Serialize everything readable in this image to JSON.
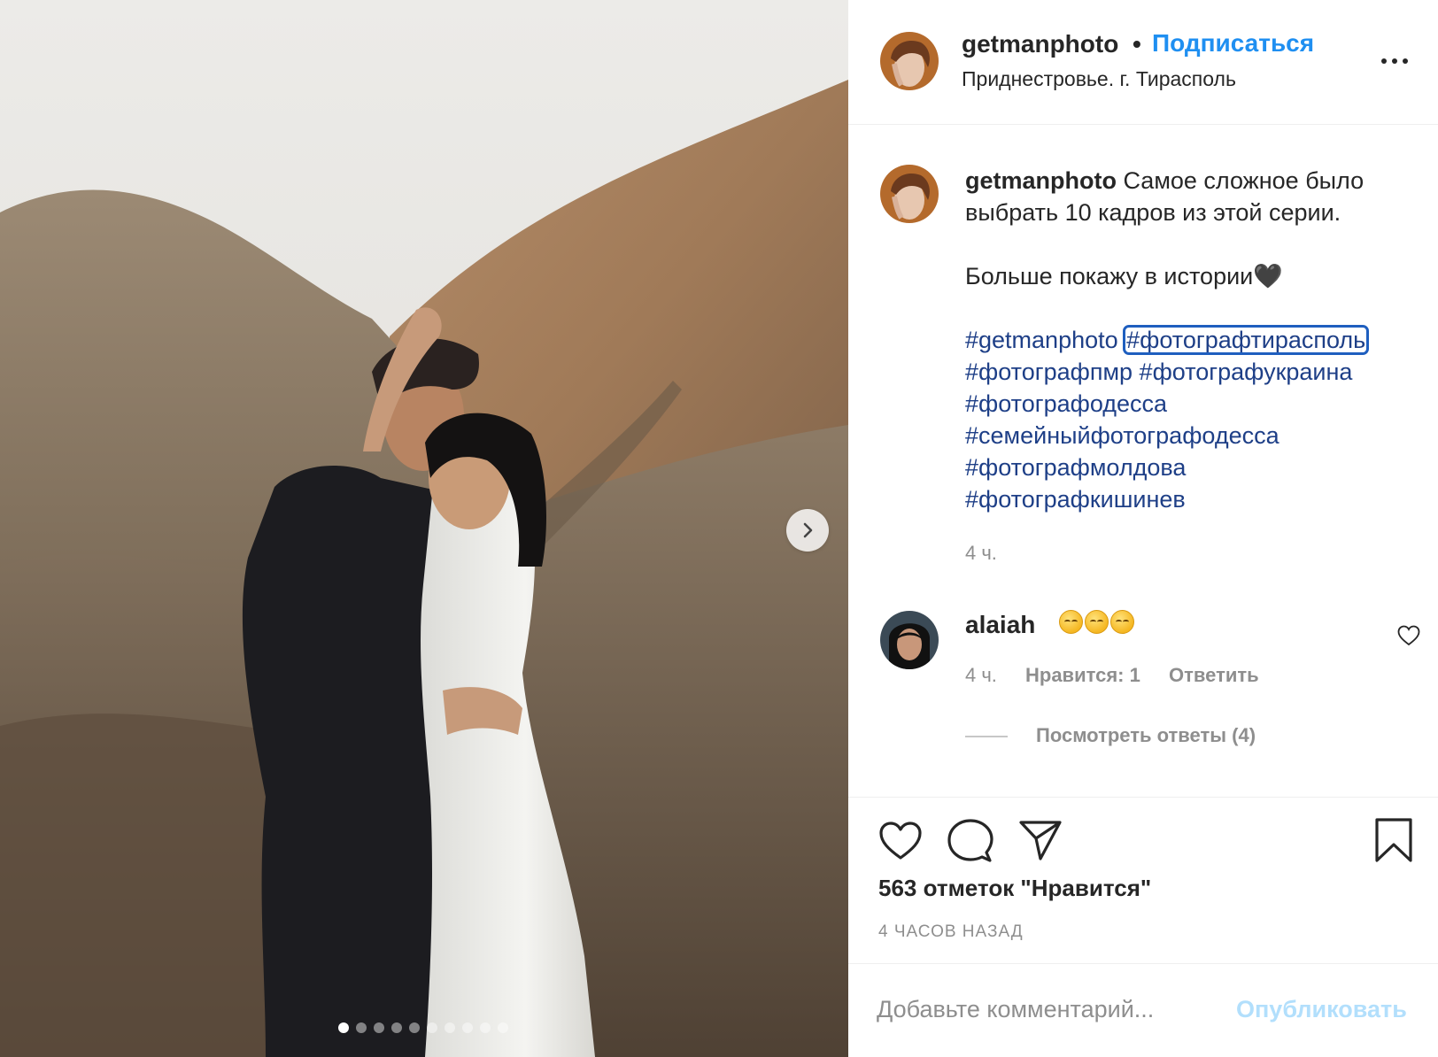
{
  "post": {
    "photo": {
      "next_icon": "chevron-right-icon",
      "carousel_total": 10,
      "carousel_active_index": 0
    },
    "header": {
      "username": "getmanphoto",
      "separator": "•",
      "follow_label": "Подписаться",
      "location": "Приднестровье. г. Тирасполь",
      "more_icon": "more-horizontal-icon"
    },
    "caption": {
      "username": "getmanphoto",
      "line1": "Самое сложное было выбрать 10 кадров из этой серии.",
      "line2": "Больше покажу в истории🖤",
      "hashtags": [
        "#getmanphoto",
        "#фотографтирасполь",
        "#фотографпмр",
        "#фотографукраина",
        "#фотографодесса",
        "#семейныйфотографодесса",
        "#фотографмолдова",
        "#фотографкишинев"
      ],
      "time": "4 ч."
    },
    "comment": {
      "username": "alaiah",
      "emoji_count": 3,
      "emoji_icon": "smiling-relieved-face-emoji",
      "time": "4 ч.",
      "likes_label": "Нравится: 1",
      "reply_label": "Ответить",
      "view_replies_label": "Посмотреть ответы (4)",
      "heart_icon": "heart-outline-icon"
    },
    "actions": {
      "like_icon": "heart-icon",
      "comment_icon": "comment-bubble-icon",
      "share_icon": "paper-plane-icon",
      "save_icon": "bookmark-icon",
      "likes_text": "563 отметок \"Нравится\"",
      "posted_ago": "4 часов назад"
    },
    "add_comment": {
      "placeholder": "Добавьте комментарий...",
      "value": "",
      "publish_label": "Опубликовать"
    },
    "colors": {
      "link_blue": "#1f8ff1",
      "hashtag_blue": "#1e3f87",
      "publish_disabled": "#b2dffc",
      "muted_text": "#8e8e8e"
    }
  }
}
